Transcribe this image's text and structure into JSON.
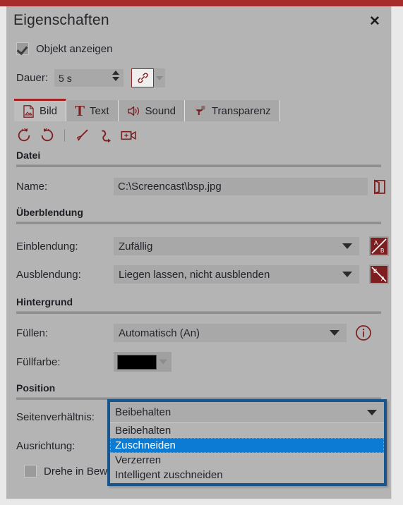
{
  "window": {
    "title": "Eigenschaften",
    "close_label": "✕"
  },
  "show_object": {
    "label": "Objekt anzeigen",
    "checked": true
  },
  "duration": {
    "label": "Dauer:",
    "value": "5 s",
    "link_icon": "chain-link-icon"
  },
  "tabs": [
    {
      "label": "Bild",
      "icon": "image-file-icon",
      "active": true
    },
    {
      "label": "Text",
      "icon": "text-t-icon",
      "active": false
    },
    {
      "label": "Sound",
      "icon": "speaker-icon",
      "active": false
    },
    {
      "label": "Transparenz",
      "icon": "transparency-icon",
      "active": false
    }
  ],
  "icon_toolbar": [
    {
      "name": "rotate-left-icon"
    },
    {
      "name": "rotate-right-icon"
    },
    {
      "name": "separator"
    },
    {
      "name": "brush-icon"
    },
    {
      "name": "curve-arrow-icon"
    },
    {
      "name": "camera-move-icon"
    }
  ],
  "sections": {
    "datei": {
      "title": "Datei",
      "name_label": "Name:",
      "name_value": "C:\\Screencast\\bsp.jpg",
      "browse_icon": "open-folder-icon"
    },
    "ueberblendung": {
      "title": "Überblendung",
      "einblendung_label": "Einblendung:",
      "einblendung_value": "Zufällig",
      "einblendung_icon": "transition-a-to-b-icon",
      "ausblendung_label": "Ausblendung:",
      "ausblendung_value": "Liegen lassen, nicht ausblenden",
      "ausblendung_icon": "transition-b-to-a-icon"
    },
    "hintergrund": {
      "title": "Hintergrund",
      "fuellen_label": "Füllen:",
      "fuellen_value": "Automatisch (An)",
      "info_icon": "info-circle-icon",
      "fuellfarbe_label": "Füllfarbe:",
      "fuellfarbe_value": "#000000"
    },
    "position": {
      "title": "Position",
      "seitenverhaeltnis_label": "Seitenverhältnis:",
      "seitenverhaeltnis_value": "Beibehalten",
      "ausrichtung_label": "Ausrichtung:",
      "drehe_label": "Drehe in Bew",
      "drehe_checked": false
    }
  },
  "dropdown": {
    "open": true,
    "current": "Beibehalten",
    "options": [
      {
        "label": "Beibehalten",
        "selected": false
      },
      {
        "label": "Zuschneiden",
        "selected": true
      },
      {
        "label": "Verzerren",
        "selected": false
      },
      {
        "label": "Intelligent zuschneiden",
        "selected": false
      }
    ]
  },
  "colors": {
    "accent_red": "#a72b2b",
    "icon_red": "#7d1f20",
    "panel_bg": "#b4b4b4",
    "highlight_blue": "#0b7bd4",
    "focus_border_blue": "#18558c"
  }
}
